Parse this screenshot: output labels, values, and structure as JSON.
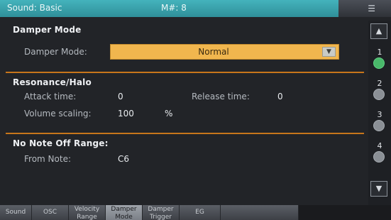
{
  "title_bar": {
    "sound": "Sound: Basic",
    "midi_channel": "M#: 8",
    "menu_icon": "menu-icon"
  },
  "sections": {
    "damper": {
      "title": "Damper Mode",
      "label": "Damper Mode:",
      "value": "Normal"
    },
    "resonance": {
      "title": "Resonance/Halo",
      "attack_label": "Attack time:",
      "attack_value": "0",
      "release_label": "Release time:",
      "release_value": "0",
      "volume_label": "Volume scaling:",
      "volume_value": "100",
      "volume_unit": "%"
    },
    "note_off": {
      "title": "No Note Off Range:",
      "from_label": "From Note:",
      "from_value": "C6"
    }
  },
  "sidebar": {
    "up_icon": "chevron-up-icon",
    "down_icon": "chevron-down-icon",
    "layers": [
      {
        "num": "1",
        "active": true
      },
      {
        "num": "2",
        "active": false
      },
      {
        "num": "3",
        "active": false
      },
      {
        "num": "4",
        "active": false
      }
    ]
  },
  "tabs": [
    {
      "line1": "Sound",
      "line2": ""
    },
    {
      "line1": "OSC",
      "line2": ""
    },
    {
      "line1": "Velocity",
      "line2": "Range"
    },
    {
      "line1": "Damper",
      "line2": "Mode",
      "active": true
    },
    {
      "line1": "Damper",
      "line2": "Trigger"
    },
    {
      "line1": "EG",
      "line2": ""
    }
  ],
  "colors": {
    "title_bar": "#3aa3ad",
    "accent_divider": "#c7761b",
    "dropdown": "#f1b64e",
    "active_layer": "#49b86a"
  }
}
